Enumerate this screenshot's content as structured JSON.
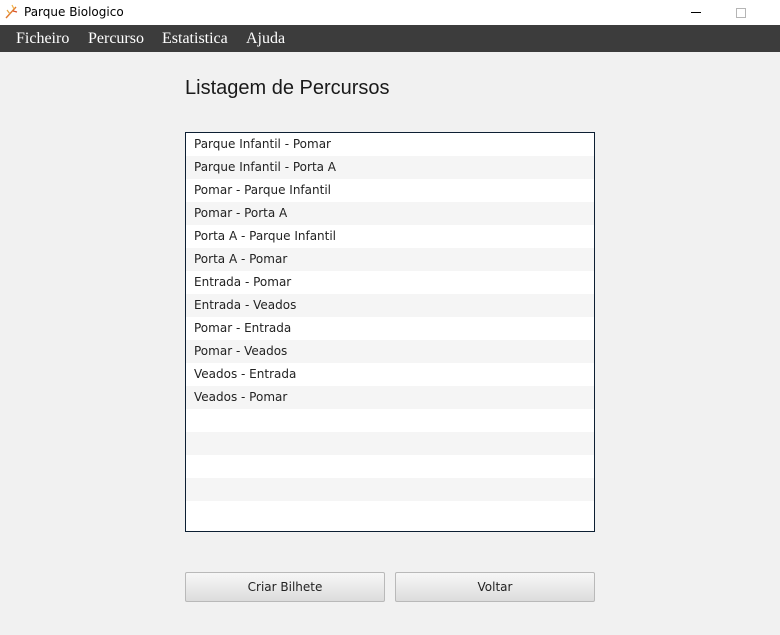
{
  "window": {
    "title": "Parque Biologico",
    "icon": "leaf-app-icon"
  },
  "menu": {
    "items": [
      "Ficheiro",
      "Percurso",
      "Estatistica",
      "Ajuda"
    ]
  },
  "main": {
    "heading": "Listagem de Percursos",
    "routes": [
      "Parque Infantil - Pomar",
      "Parque Infantil - Porta A",
      "Pomar - Parque Infantil",
      "Pomar - Porta A",
      "Porta A - Parque Infantil",
      "Porta A - Pomar",
      "Entrada - Pomar",
      "Entrada - Veados",
      "Pomar - Entrada",
      "Pomar - Veados",
      "Veados - Entrada",
      "Veados - Pomar"
    ],
    "buttons": {
      "criar_bilhete": "Criar Bilhete",
      "voltar": "Voltar"
    }
  }
}
